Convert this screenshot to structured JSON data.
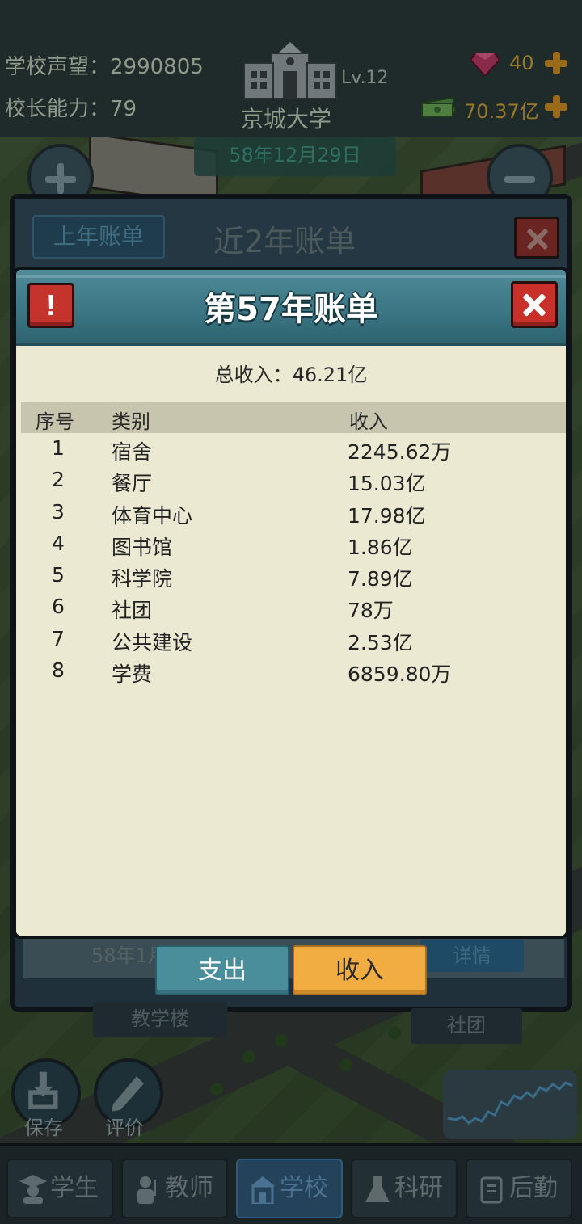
{
  "hud": {
    "reputation": "学校声望：2990805",
    "principal_ability": "校长能力：79",
    "level": "Lv.12",
    "school_name": "京城大学",
    "gems": "40",
    "money": "70.37亿",
    "date": "58年12月29日"
  },
  "back_panel": {
    "prev_year_label": "上年账单",
    "title": "近2年账单",
    "row_date": "58年1月",
    "details_label": "详情"
  },
  "modal": {
    "title": "第57年账单",
    "total_income": "总收入：46.21亿",
    "columns": [
      "序号",
      "类别",
      "收入"
    ],
    "rows": [
      {
        "idx": "1",
        "category": "宿舍",
        "income": "2245.62万"
      },
      {
        "idx": "2",
        "category": "餐厅",
        "income": "15.03亿"
      },
      {
        "idx": "3",
        "category": "体育中心",
        "income": "17.98亿"
      },
      {
        "idx": "4",
        "category": "图书馆",
        "income": "1.86亿"
      },
      {
        "idx": "5",
        "category": "科学院",
        "income": "7.89亿"
      },
      {
        "idx": "6",
        "category": "社团",
        "income": "78万"
      },
      {
        "idx": "7",
        "category": "公共建设",
        "income": "2.53亿"
      },
      {
        "idx": "8",
        "category": "学费",
        "income": "6859.80万"
      }
    ],
    "tab_expense": "支出",
    "tab_income": "收入"
  },
  "scene": {
    "tag_teaching": "教学楼",
    "tag_club": "社团",
    "save_label": "保存",
    "rate_label": "评价"
  },
  "nav": {
    "students": "学生",
    "teachers": "教师",
    "school": "学校",
    "research": "科研",
    "logistics": "后勤"
  },
  "colors": {
    "modal_header": "#3b7482",
    "modal_body": "#ece9d3",
    "income_tab": "#f2ad42",
    "expense_tab": "#4a8e9c",
    "close_red": "#c9302a"
  }
}
